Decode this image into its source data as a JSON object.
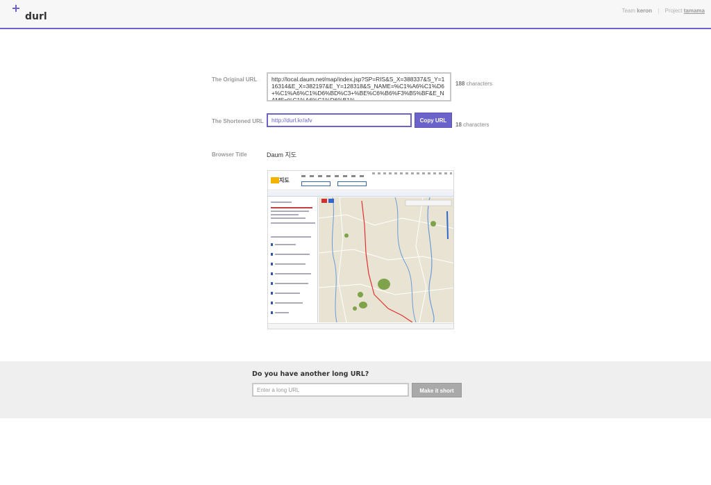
{
  "header": {
    "logo_text": "durl",
    "team_label": "Team",
    "team_name": "keron",
    "project_label": "Project",
    "project_name": "tamama",
    "separator": "|"
  },
  "result": {
    "original_label": "The Original URL",
    "original_url": "http://local.daum.net/map/index.jsp?SP=RIS&S_X=388337&S_Y=116314&E_X=382197&E_Y=128318&S_NAME=%C1%A6%C1%D6+%C1%A6%C1%D6%BD%C3+%BE%C6%B6%F3%B5%BF&E_NAME=%C1%A6%C1%D6%B1%",
    "original_count": "188",
    "characters_word": "characters",
    "short_label": "The Shortened URL",
    "short_url": "http://durl.kr/afv",
    "short_count": "18",
    "copy_button": "Copy URL",
    "title_label": "Browser Title",
    "title_value": "Daum 지도",
    "thumbnail_logo": "지도"
  },
  "form": {
    "question": "Do you have another long URL?",
    "placeholder": "Enter a long URL",
    "submit": "Make it short"
  },
  "colors": {
    "accent": "#6b63c9",
    "button_disabled": "#a9a9a9"
  }
}
